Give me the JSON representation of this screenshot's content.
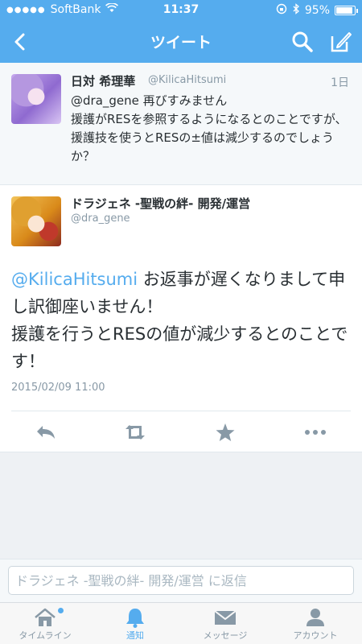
{
  "status_bar": {
    "carrier": "SoftBank",
    "time": "11:37",
    "battery": "95%"
  },
  "nav": {
    "title": "ツイート",
    "back_icon": "chevron-left-icon",
    "search_icon": "search-icon",
    "compose_icon": "compose-icon"
  },
  "reply_tweet": {
    "name": "日対 希理華",
    "handle": "@KilicaHitsumi",
    "time": "1日",
    "mention": "@dra_gene",
    "text": " 再びすみません\n援護がRESを参照するようになるとのことですが、援護技を使うとRESの±値は減少するのでしょうか？"
  },
  "main_tweet": {
    "name": "ドラジェネ -聖戦の絆- 開発/運営",
    "handle": "@dra_gene",
    "mention": "@KilicaHitsumi",
    "text": " お返事が遅くなりまして申し訳御座いません！\n援護を行うとRESの値が減少するとのことです！",
    "date": "2015/02/09 11:00",
    "actions": [
      "reply-icon",
      "retweet-icon",
      "favorite-icon",
      "more-icon"
    ]
  },
  "reply_bar": {
    "placeholder": "ドラジェネ -聖戦の絆- 開発/運営 に返信"
  },
  "tabbar": {
    "tabs": [
      {
        "label": "タイムライン",
        "icon": "home-icon",
        "active": false
      },
      {
        "label": "通知",
        "icon": "bell-icon",
        "active": true
      },
      {
        "label": "メッセージ",
        "icon": "envelope-icon",
        "active": false
      },
      {
        "label": "アカウント",
        "icon": "person-icon",
        "active": false
      }
    ]
  },
  "colors": {
    "accent": "#55acee",
    "text": "#292f33",
    "muted": "#8899a6"
  }
}
